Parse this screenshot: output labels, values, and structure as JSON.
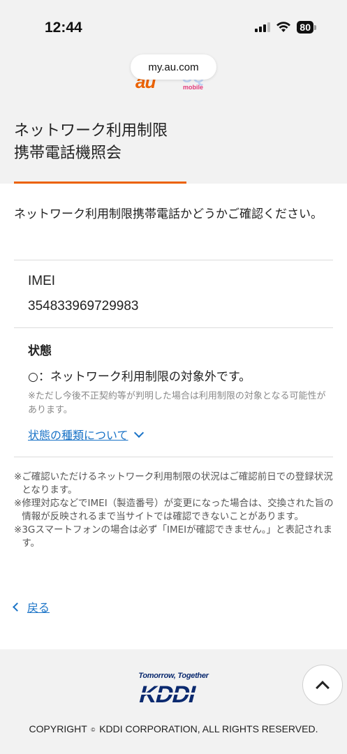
{
  "status_bar": {
    "time": "12:44",
    "battery": "80"
  },
  "browser": {
    "url": "my.au.com"
  },
  "brand": {
    "au": "au",
    "uq_letters": "UQ",
    "uq_sub": "mobile"
  },
  "page": {
    "title_line1": "ネットワーク利用制限",
    "title_line2": "携帯電話機照会",
    "intro": "ネットワーク利用制限携帯電話かどうかご確認ください。"
  },
  "imei": {
    "label": "IMEI",
    "value": "354833969729983"
  },
  "status": {
    "label": "状態",
    "result": "○：ネットワーク利用制限の対象外です。",
    "note": "※ただし今後不正契約等が判明した場合は利用制限の対象となる可能性があります。",
    "types_link": "状態の種類について"
  },
  "notes": [
    {
      "mark": "※",
      "text": "ご確認いただけるネットワーク利用制限の状況はご確認前日での登録状況となります。"
    },
    {
      "mark": "※",
      "text": "修理対応などでIMEI（製造番号）が変更になった場合は、交換された旨の情報が反映されるまで当サイトでは確認できないことがあります。"
    },
    {
      "mark": "※",
      "text": "3Gスマートフォンの場合は必ず「IMEIが確認できません。」と表記されます。"
    }
  ],
  "back": {
    "label": "戻る"
  },
  "footer": {
    "slogan": "Tomorrow, Together",
    "logo_text": "KDDI",
    "copyright_pre": "COPYRIGHT",
    "copyright_mark": "©",
    "copyright_post": "KDDI CORPORATION, ALL RIGHTS RESERVED."
  },
  "colors": {
    "accent": "#eb6100",
    "link": "#1a73c7",
    "kddi_blue": "#0b2a6f",
    "background_gray": "#f2f2f2"
  },
  "icons": [
    "signal-icon",
    "wifi-icon",
    "battery-icon",
    "chevron-down-icon",
    "chevron-left-icon",
    "chevron-up-icon"
  ]
}
